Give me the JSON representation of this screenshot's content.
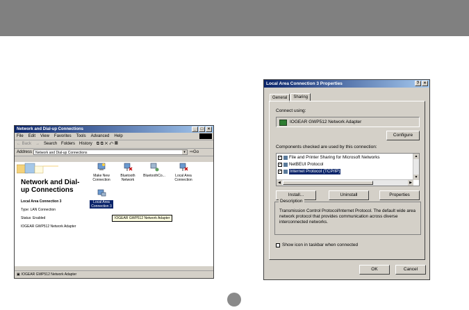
{
  "left_window": {
    "title": "Network and Dial-up Connections",
    "menu": [
      "File",
      "Edit",
      "View",
      "Favorites",
      "Tools",
      "Advanced",
      "Help"
    ],
    "toolbar": {
      "back": "← Back",
      "forward": "→",
      "search": "Search",
      "folders": "Folders",
      "history": "History"
    },
    "address_label": "Address",
    "address_value": "Network and Dial-up Connections",
    "go": "Go",
    "pane_title": "Network and Dial-up Connections",
    "info": {
      "name": "Local Area Connection 3",
      "type": "Type: LAN Connection",
      "status": "Status: Enabled",
      "adapter": "IOGEAR GWP512 Network Adapter"
    },
    "icons": [
      "Make New Connection",
      "Bluetooth Network",
      "BluetoothCo...",
      "Local Area Connection",
      "Local Area Connection 3"
    ],
    "tooltip": "IOGEAR GWP512 Network Adapter",
    "status_bar": "IOGEAR GWP512 Network Adapter"
  },
  "dialog": {
    "title": "Local Area Connection 3 Properties",
    "help_btn": "?",
    "close_btn": "×",
    "tabs": [
      "General",
      "Sharing"
    ],
    "connect_using_label": "Connect using:",
    "adapter": "IOGEAR GWP512 Network Adapter",
    "configure": "Configure",
    "components_label": "Components checked are used by this connection:",
    "components": [
      "File and Printer Sharing for Microsoft Networks",
      "NetBEUI Protocol",
      "Internet Protocol (TCP/IP)"
    ],
    "install": "Install...",
    "uninstall": "Uninstall",
    "properties": "Properties",
    "description_label": "Description",
    "description": "Transmission Control Protocol/Internet Protocol. The default wide area network protocol that provides communication across diverse interconnected networks.",
    "show_icon": "Show icon in taskbar when connected",
    "ok": "OK",
    "cancel": "Cancel"
  }
}
